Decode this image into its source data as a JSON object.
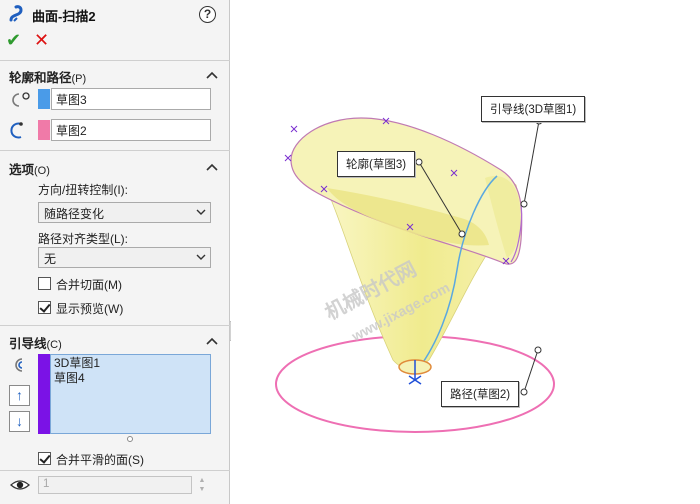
{
  "panel": {
    "title": "曲面-扫描2",
    "help": "?",
    "ok": "✔",
    "cancel": "✕",
    "profile_group": {
      "title": "轮廓和路径",
      "hotkey": "(P)",
      "profile_value": "草图3",
      "path_value": "草图2"
    },
    "options_group": {
      "title": "选项",
      "hotkey": "(O)",
      "orientation_label": "方向/扭转控制",
      "orientation_hotkey": "(I):",
      "orientation_value": "随路径变化",
      "path_align_label": "路径对齐类型",
      "path_align_hotkey": "(L):",
      "path_align_value": "无",
      "merge_tangent_label": "合并切面",
      "merge_tangent_hotkey": "(M)",
      "merge_tangent_checked": false,
      "show_preview_label": "显示预览",
      "show_preview_hotkey": "(W)",
      "show_preview_checked": true
    },
    "guide_group": {
      "title": "引导线",
      "hotkey": "(C)",
      "items": [
        "3D草图1",
        "草图4"
      ],
      "merge_smooth_label": "合并平滑的面",
      "merge_smooth_hotkey": "(S)",
      "merge_smooth_checked": true,
      "spin_value": "1"
    },
    "colors": {
      "profile_swatch": "#4a9be8",
      "path_swatch": "#f07aa8",
      "guide_swatch": "#7b12e6"
    }
  },
  "viewport": {
    "callouts": {
      "guide": "引导线(3D草图1)",
      "profile": "轮廓(草图3)",
      "path": "路径(草图2)"
    },
    "watermark": {
      "line1": "机械时代网",
      "line2": "www.jixage.com"
    },
    "colors": {
      "surface": "#f4f1a6",
      "path_circle": "#ee6fb3",
      "guide_curve": "#5aa8e0"
    }
  }
}
